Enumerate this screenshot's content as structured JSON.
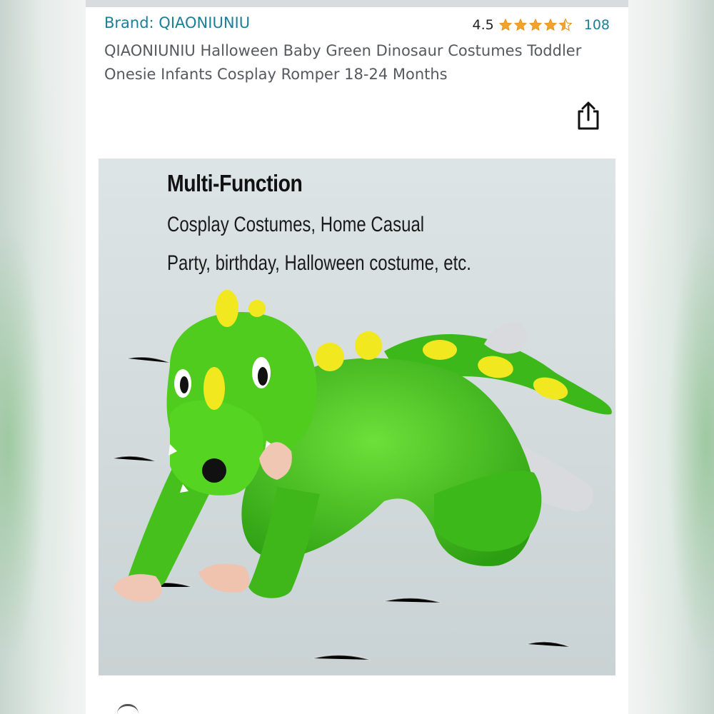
{
  "product": {
    "brand_label": "Brand: QIAONIUNIU",
    "rating_value": "4.5",
    "rating_stars": 4.5,
    "rating_count": "108",
    "title": "QIAONIUNIU Halloween Baby Green Dinosaur Costumes Toddler Onesie Infants Cosplay Romper 18-24 Months"
  },
  "hero_image": {
    "heading": "Multi-Function",
    "line1": "Cosplay Costumes, Home Casual",
    "line2": "Party, birthday, Halloween costume,  etc."
  },
  "icons": {
    "share": "share-icon",
    "star": "star-icon"
  },
  "colors": {
    "link": "#1d7f96",
    "star": "#f3a32a",
    "costume_green": "#4cc21c",
    "spikes": "#f2e820"
  }
}
